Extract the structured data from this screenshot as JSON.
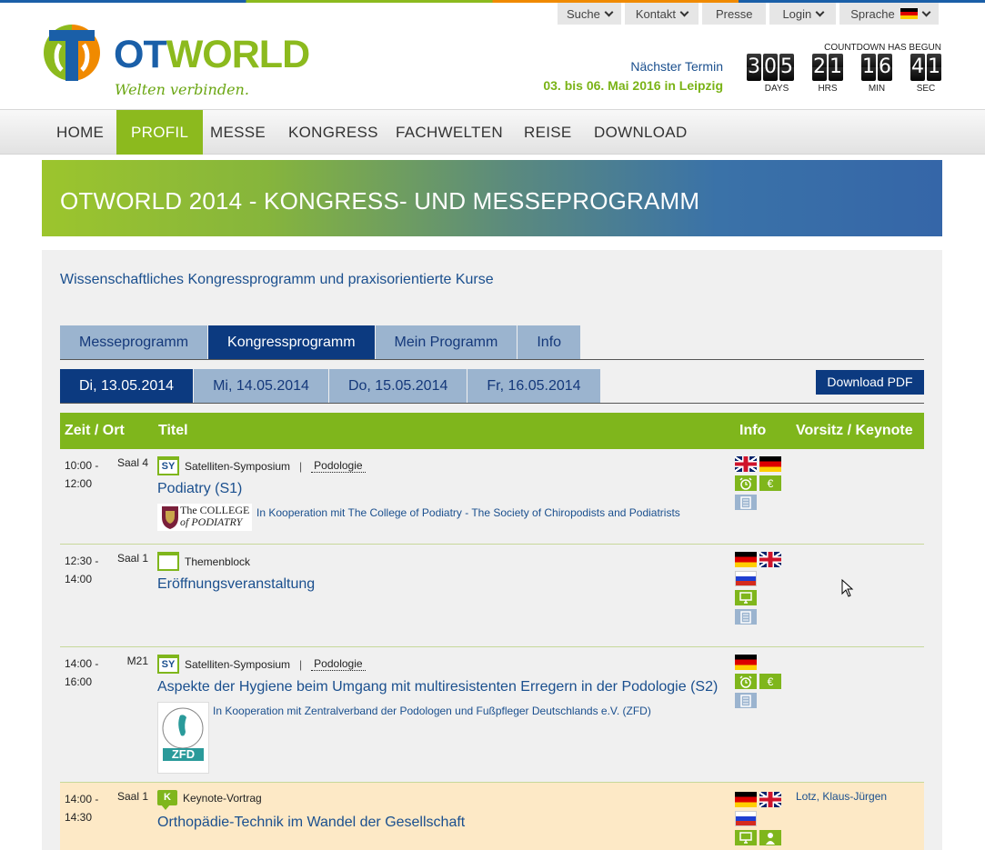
{
  "utility": {
    "search": "Suche",
    "contact": "Kontakt",
    "press": "Presse",
    "login": "Login",
    "language": "Sprache"
  },
  "logo": {
    "text_ot": "OT",
    "text_world": "WORLD",
    "slogan": "Welten verbinden."
  },
  "next_event": {
    "label": "Nächster Termin",
    "date": "03. bis 06. Mai 2016 in Leipzig"
  },
  "countdown": {
    "title": "COUNTDOWN HAS BEGUN",
    "days": "305",
    "hrs": "21",
    "min": "16",
    "sec": "41",
    "days_label": "DAYS",
    "hrs_label": "HRS",
    "min_label": "MIN",
    "sec_label": "SEC"
  },
  "nav": [
    "HOME",
    "PROFIL",
    "MESSE",
    "KONGRESS",
    "FACHWELTEN",
    "REISE",
    "DOWNLOAD"
  ],
  "hero_title": "OTWORLD 2014 - KONGRESS- UND MESSEPROGRAMM",
  "subtitle": "Wissenschaftliches Kongressprogramm und praxisorientierte Kurse",
  "tabs": [
    "Messeprogramm",
    "Kongressprogramm",
    "Mein Programm",
    "Info"
  ],
  "days": [
    "Di, 13.05.2014",
    "Mi, 14.05.2014",
    "Do, 15.05.2014",
    "Fr, 16.05.2014"
  ],
  "download_pdf": "Download PDF",
  "table_head": {
    "time": "Zeit / Ort",
    "title": "Titel",
    "info": "Info",
    "chair": "Vorsitz / Keynote"
  },
  "rows": [
    {
      "time_start": "10:00 -",
      "time_end": "12:00",
      "room": "Saal 4",
      "type": "Satelliten-Symposium",
      "type_icon": "SY",
      "field": "Podologie",
      "title": "Podiatry (S1)",
      "coop": "In Kooperation mit The College of Podiatry - The Society of Chiropodists and Podiatrists",
      "coop_logo_line1": "The COLLEGE",
      "coop_logo_line2": "of PODIATRY"
    },
    {
      "time_start": "12:30 -",
      "time_end": "14:00",
      "room": "Saal 1",
      "type": "Themenblock",
      "title": "Eröffnungsveranstaltung"
    },
    {
      "time_start": "14:00 -",
      "time_end": "16:00",
      "room": "M21",
      "type": "Satelliten-Symposium",
      "type_icon": "SY",
      "field": "Podologie",
      "title": "Aspekte der Hygiene beim Umgang mit multiresistenten Erregern in der Podologie (S2)",
      "coop": "In Kooperation mit Zentralverband der Podologen und Fußpfleger Deutschlands e.V. (ZFD)",
      "coop_logo": "ZFD"
    },
    {
      "time_start": "14:00 -",
      "time_end": "14:30",
      "room": "Saal 1",
      "type": "Keynote-Vortrag",
      "type_icon": "K",
      "title": "Orthopädie-Technik im Wandel der Gesellschaft",
      "chair": "Lotz, Klaus-Jürgen"
    }
  ],
  "icons": {
    "euro": "€"
  },
  "colors": {
    "brand_green": "#8cba1e",
    "brand_blue": "#1a5fa8",
    "tab_active": "#0c3a80",
    "tab_inactive": "#9bb4cf",
    "highlight_row": "#fde9c6"
  }
}
